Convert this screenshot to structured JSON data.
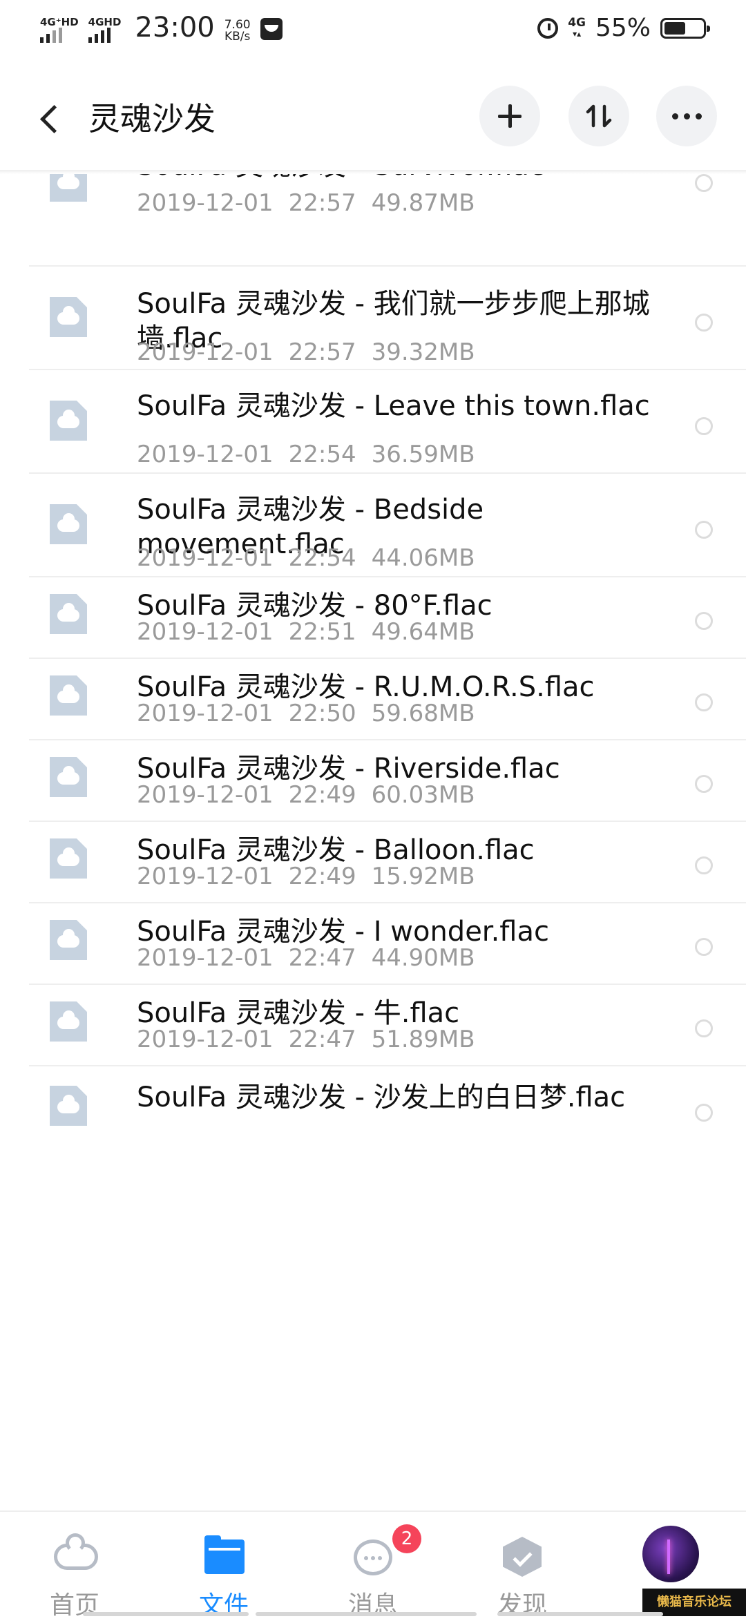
{
  "status_bar": {
    "sim1": "4G⁺HD",
    "sim2": "4GHD",
    "time": "23:00",
    "speed_value": "7.60",
    "speed_unit": "KB/s",
    "network": "4G",
    "battery_percent": "55%",
    "battery_level": 0.55
  },
  "header": {
    "title": "灵魂沙发",
    "icons": [
      "back-icon",
      "plus-icon",
      "sort-icon",
      "more-icon"
    ]
  },
  "files": [
    {
      "name": "SoulFa 灵魂沙发 - Survivor.flac",
      "date": "2019-12-01",
      "time": "22:57",
      "size": "49.87MB"
    },
    {
      "name": "SoulFa 灵魂沙发 - 我们就一步步爬上那城墙.flac",
      "date": "2019-12-01",
      "time": "22:57",
      "size": "39.32MB"
    },
    {
      "name": "SoulFa 灵魂沙发 - Leave this town.flac",
      "date": "2019-12-01",
      "time": "22:54",
      "size": "36.59MB"
    },
    {
      "name": "SoulFa 灵魂沙发 - Bedside movement.flac",
      "date": "2019-12-01",
      "time": "22:54",
      "size": "44.06MB"
    },
    {
      "name": "SoulFa 灵魂沙发 - 80°F.flac",
      "date": "2019-12-01",
      "time": "22:51",
      "size": "49.64MB"
    },
    {
      "name": "SoulFa 灵魂沙发 - R.U.M.O.R.S.flac",
      "date": "2019-12-01",
      "time": "22:50",
      "size": "59.68MB"
    },
    {
      "name": "SoulFa 灵魂沙发 - Riverside.flac",
      "date": "2019-12-01",
      "time": "22:49",
      "size": "60.03MB"
    },
    {
      "name": "SoulFa 灵魂沙发 - Balloon.flac",
      "date": "2019-12-01",
      "time": "22:49",
      "size": "15.92MB"
    },
    {
      "name": "SoulFa 灵魂沙发 - I wonder.flac",
      "date": "2019-12-01",
      "time": "22:47",
      "size": "44.90MB"
    },
    {
      "name": "SoulFa 灵魂沙发 - 牛.flac",
      "date": "2019-12-01",
      "time": "22:47",
      "size": "51.89MB"
    },
    {
      "name": "SoulFa 灵魂沙发 - 沙发上的白日梦.flac",
      "date": "",
      "time": "",
      "size": ""
    }
  ],
  "bottom_nav": {
    "items": [
      {
        "label": "首页",
        "icon": "home-cloud-icon",
        "active": false
      },
      {
        "label": "文件",
        "icon": "folder-icon",
        "active": true
      },
      {
        "label": "消息",
        "icon": "message-icon",
        "active": false,
        "badge": "2"
      },
      {
        "label": "发现",
        "icon": "discover-icon",
        "active": false
      },
      {
        "label": "",
        "icon": "avatar",
        "active": false
      }
    ]
  },
  "watermark": "懒猫音乐论坛",
  "colors": {
    "accent": "#1a8cff",
    "badge": "#f5445a",
    "file_icon": "#c7d3e0",
    "meta_text": "#9a9a9a"
  }
}
